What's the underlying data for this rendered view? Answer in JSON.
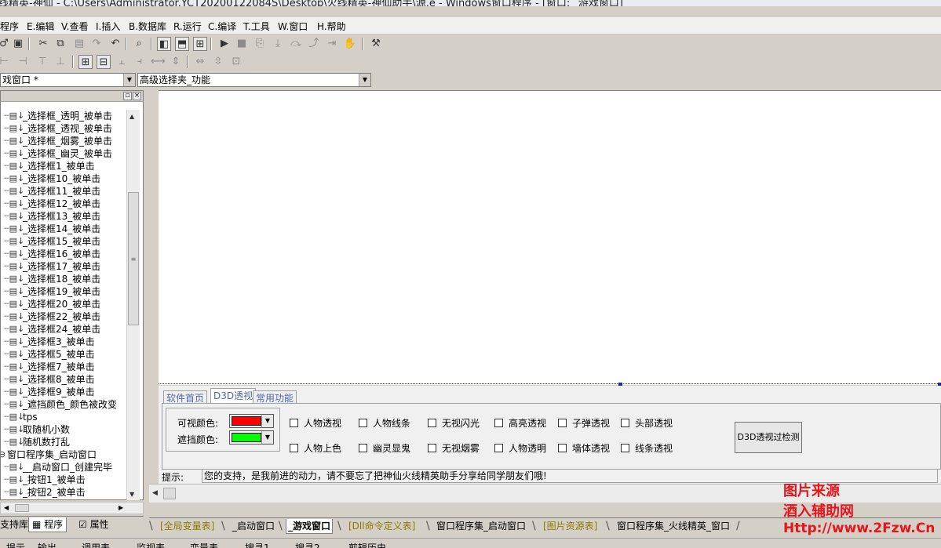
{
  "window": {
    "title": "线精英-神仙 - C:\\Users\\Administrator.YCT20200122084S\\Desktop\\火线精英-神仙助手\\源.e - Windows窗口程序 - [窗口: _游戏窗口]"
  },
  "menu": [
    "程序",
    "E.编辑",
    "V.查看",
    "I.插入",
    "B.数据库",
    "R.运行",
    "C.编译",
    "T.工具",
    "W.窗口",
    "H.帮助"
  ],
  "combos": {
    "window_select": "戏窗口 *",
    "event_select": "高级选择夹_功能"
  },
  "tree": {
    "items": [
      "_选择框_透明_被单击",
      "_选择框_透视_被单击",
      "_选择框_烟雾_被单击",
      "_选择框_幽灵_被单击",
      "_选择框1_被单击",
      "_选择框10_被单击",
      "_选择框11_被单击",
      "_选择框12_被单击",
      "_选择框13_被单击",
      "_选择框14_被单击",
      "_选择框15_被单击",
      "_选择框16_被单击",
      "_选择框17_被单击",
      "_选择框18_被单击",
      "_选择框19_被单击",
      "_选择框20_被单击",
      "_选择框22_被单击",
      "_选择框24_被单击",
      "_选择框3_被单击",
      "_选择框5_被单击",
      "_选择框7_被单击",
      "_选择框8_被单击",
      "_选择框9_被单击",
      "_遮挡颜色_颜色被改变",
      "tps",
      "取随机小数",
      "随机数打乱",
      "窗口程序集_启动窗口",
      "__启动窗口_创建完毕",
      "_按钮1_被单击",
      "_按钮2_被单击"
    ],
    "group_item": "窗口程序集_启动窗口"
  },
  "left_tabs": [
    "支持库",
    "程序",
    "属性"
  ],
  "form": {
    "tabs": [
      "软件首页",
      "D3D透视",
      "常用功能"
    ],
    "active_tab": "D3D透视",
    "visible_color_label": "可视颜色:",
    "visible_color": "#ff0000",
    "occlude_color_label": "遮挡颜色:",
    "occlude_color": "#00ff00",
    "checkboxes_row1": [
      "人物透视",
      "人物线条",
      "无视闪光",
      "高亮透视",
      "子弹透视",
      "头部透视"
    ],
    "checkboxes_row2": [
      "人物上色",
      "幽灵显鬼",
      "无视烟雾",
      "人物透明",
      "墙体透视",
      "线条透视"
    ],
    "detect_button": "D3D透视过检测",
    "tip_label": "提示:",
    "tip_text": "您的支持，是我前进的动力，请不要忘了把神仙火线精英助手分享给同学朋友们哦!"
  },
  "doc_tabs": [
    "[全局变量表]",
    "_启动窗口",
    "_游戏窗口",
    "[Dll命令定义表]",
    "窗口程序集_启动窗口",
    "[图片资源表]",
    "窗口程序集_火线精英_窗口"
  ],
  "status_tabs": [
    "提示",
    "输出",
    "调用表",
    "监视表",
    "变量表",
    "搜寻1",
    "搜寻2",
    "剪辑历史"
  ],
  "watermark": {
    "line1": "图片来源",
    "line2": "酒入辅助网",
    "line3": "Http://www.2Fzw.Cn"
  },
  "colors": {
    "accent_tab": "#4a6aa8",
    "watermark": "#e8141a"
  }
}
